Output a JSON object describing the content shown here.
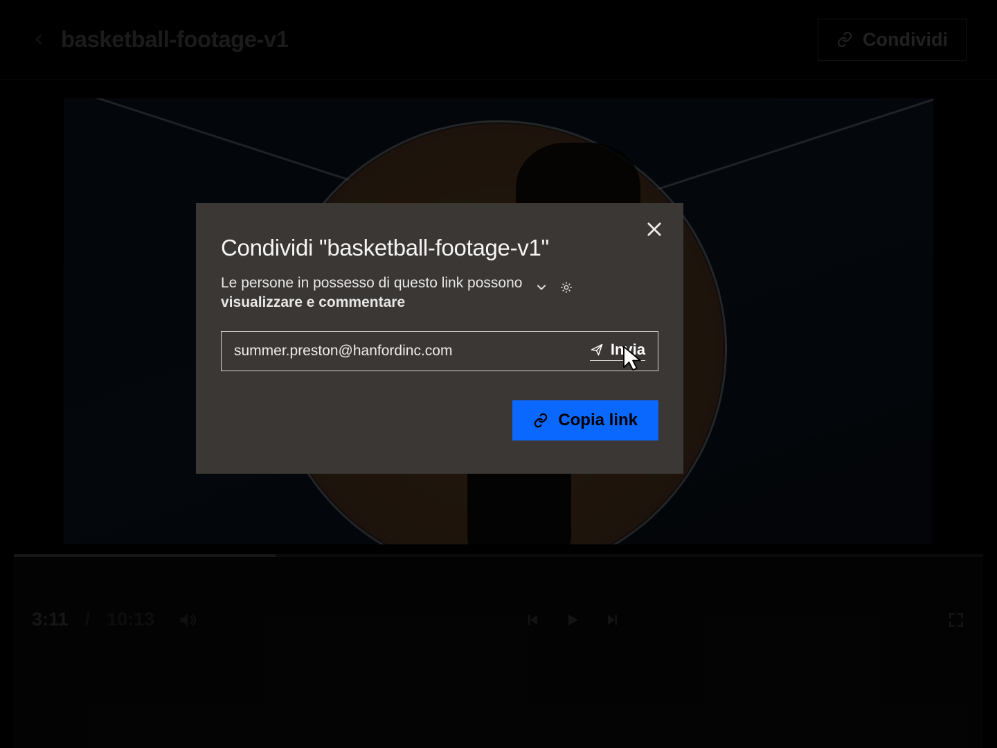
{
  "header": {
    "title": "basketball-footage-v1",
    "share_button": "Condividi"
  },
  "player": {
    "current_time": "3:11",
    "total_time": "10:13",
    "separator": "/",
    "progress_percent": 27
  },
  "modal": {
    "title": "Condividi \"basketball-footage-v1\"",
    "permission_prefix": "Le persone in possesso di questo link possono",
    "permission_value": "visualizzare e commentare",
    "email_value": "summer.preston@hanfordinc.com",
    "send_label": "Invia",
    "copy_label": "Copia link"
  },
  "icons": {
    "back": "chevron-left-icon",
    "share_link": "link-icon",
    "close": "close-icon",
    "chevron_down": "chevron-down-icon",
    "gear": "gear-icon",
    "send": "paper-plane-icon",
    "volume": "volume-icon",
    "prev": "step-back-icon",
    "play": "play-icon",
    "next": "step-forward-icon",
    "fullscreen": "fullscreen-icon",
    "cursor": "cursor-icon"
  },
  "colors": {
    "accent": "#0a68ff",
    "modal_bg": "#3b3734"
  }
}
